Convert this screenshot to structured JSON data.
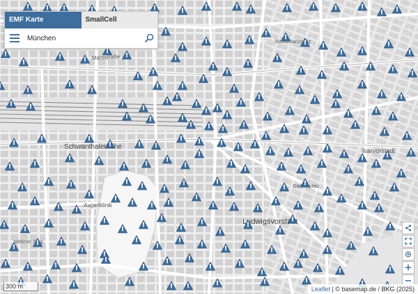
{
  "tabs": {
    "emf_label": "EMF Karte",
    "smallcell_label": "SmallCell"
  },
  "search": {
    "value": "München"
  },
  "scale": {
    "label": "300 m"
  },
  "attribution": {
    "leaflet": "Leaflet",
    "text": "| © basemap.de / BKG (2025)"
  },
  "colors": {
    "marker": "#3b6fa0",
    "marker_dark": "#2b557f",
    "accent": "#3d6e9e",
    "road": "#ffffff",
    "block": "#d2d2d2"
  },
  "map_labels": [
    "Marsstraße",
    "Schwanthalerhöhe",
    "Augenklinik",
    "Ludwigsvorstadt",
    "Isarvorstadt",
    "Mittlerer Ring",
    "Maximiliansplatz",
    "Gärtnerplatz"
  ]
}
